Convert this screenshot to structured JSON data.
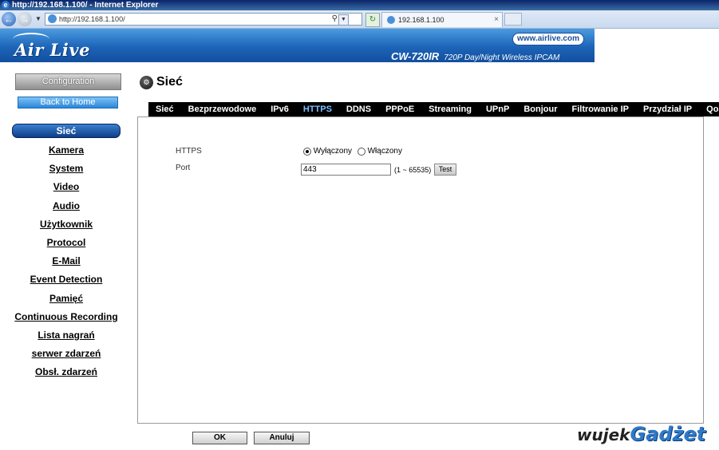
{
  "window": {
    "title": "http://192.168.1.100/ - Internet Explorer"
  },
  "browser": {
    "url": "http://192.168.1.100/",
    "tab_title": "192.168.1.100",
    "tab_close": "×"
  },
  "banner": {
    "logo": "Air Live",
    "site": "www.airlive.com",
    "model": "CW-720IR",
    "model_desc": "720P Day/Night Wireless IPCAM"
  },
  "sidebar": {
    "config_button": "Configuration",
    "home_button": "Back to Home",
    "items": [
      {
        "label": "Sieć",
        "active": true
      },
      {
        "label": "Kamera"
      },
      {
        "label": "System"
      },
      {
        "label": "Video"
      },
      {
        "label": "Audio"
      },
      {
        "label": "Użytkownik"
      },
      {
        "label": "Protocol"
      },
      {
        "label": "E-Mail"
      },
      {
        "label": "Event Detection"
      },
      {
        "label": "Pamięć"
      },
      {
        "label": "Continuous Recording"
      },
      {
        "label": "Lista nagrań"
      },
      {
        "label": "serwer zdarzeń"
      },
      {
        "label": "Obsł. zdarzeń"
      }
    ]
  },
  "page": {
    "title": "Sieć",
    "tabs": [
      {
        "label": "Sieć"
      },
      {
        "label": "Bezprzewodowe"
      },
      {
        "label": "IPv6"
      },
      {
        "label": "HTTPS",
        "active": true
      },
      {
        "label": "DDNS"
      },
      {
        "label": "PPPoE"
      },
      {
        "label": "Streaming"
      },
      {
        "label": "UPnP"
      },
      {
        "label": "Bonjour"
      },
      {
        "label": "Filtrowanie IP"
      },
      {
        "label": "Przydział IP"
      },
      {
        "label": "QoS"
      }
    ]
  },
  "form": {
    "https_label": "HTTPS",
    "https_options": [
      {
        "label": "Wyłączony",
        "selected": true
      },
      {
        "label": "Włączony",
        "selected": false
      }
    ],
    "port_label": "Port",
    "port_value": "443",
    "port_range": "(1 ~ 65535)",
    "test_button": "Test"
  },
  "footer": {
    "ok_button": "OK",
    "cancel_button": "Anuluj"
  },
  "watermark": {
    "part1": "wujek",
    "part2": "Gadżet"
  }
}
